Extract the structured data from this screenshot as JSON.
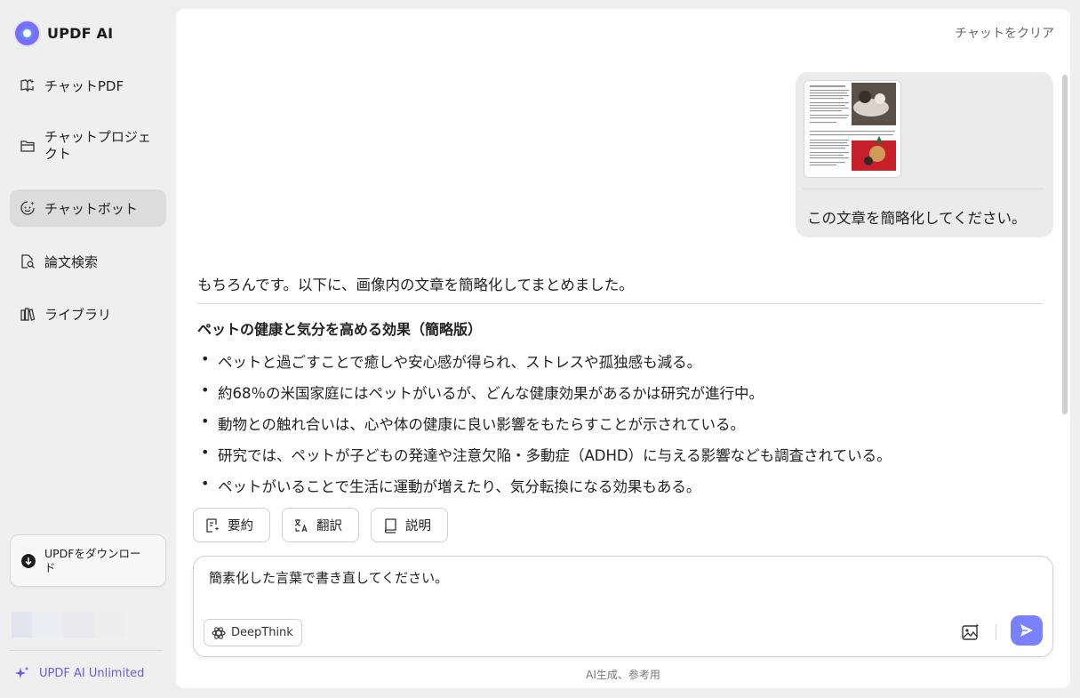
{
  "app": {
    "brand": "UPDF AI"
  },
  "sidebar": {
    "items": [
      {
        "label": "チャットPDF",
        "icon": "book-sparkle-icon"
      },
      {
        "label": "チャットプロジェクト",
        "icon": "folder-icon"
      },
      {
        "label": "チャットボット",
        "icon": "bot-icon",
        "active": true
      },
      {
        "label": "論文検索",
        "icon": "doc-search-icon"
      },
      {
        "label": "ライブラリ",
        "icon": "library-icon"
      }
    ],
    "download_label": "UPDFをダウンロード",
    "unlimited_label": "UPDF AI Unlimited"
  },
  "header": {
    "clear_label": "チャットをクリア"
  },
  "chat": {
    "user_message": "この文章を簡略化してください。",
    "answer_intro": "もちろんです。以下に、画像内の文章を簡略化してまとめました。",
    "answer_heading": "ペットの健康と気分を高める効果（簡略版）",
    "bullets": [
      "ペットと過ごすことで癒しや安心感が得られ、ストレスや孤独感も減る。",
      "約68％の米国家庭にはペットがいるが、どんな健康効果があるかは研究が進行中。",
      "動物との触れ合いは、心や体の健康に良い影響をもたらすことが示されている。",
      "研究では、ペットが子どもの発達や注意欠陥・多動症（ADHD）に与える影響なども調査されている。",
      "ペットがいることで生活に運動が増えたり、気分転換になる効果もある。"
    ]
  },
  "actions": {
    "summarize": "要約",
    "translate": "翻訳",
    "explain": "説明"
  },
  "composer": {
    "value": "簡素化した言葉で書き直してください。",
    "deepthink_label": "DeepThink"
  },
  "footer": {
    "note": "AI生成、参考用"
  },
  "colors": {
    "accent": "#7b80ff",
    "purple_text": "#6d5ae0",
    "active_nav": "#dcdcdc"
  }
}
